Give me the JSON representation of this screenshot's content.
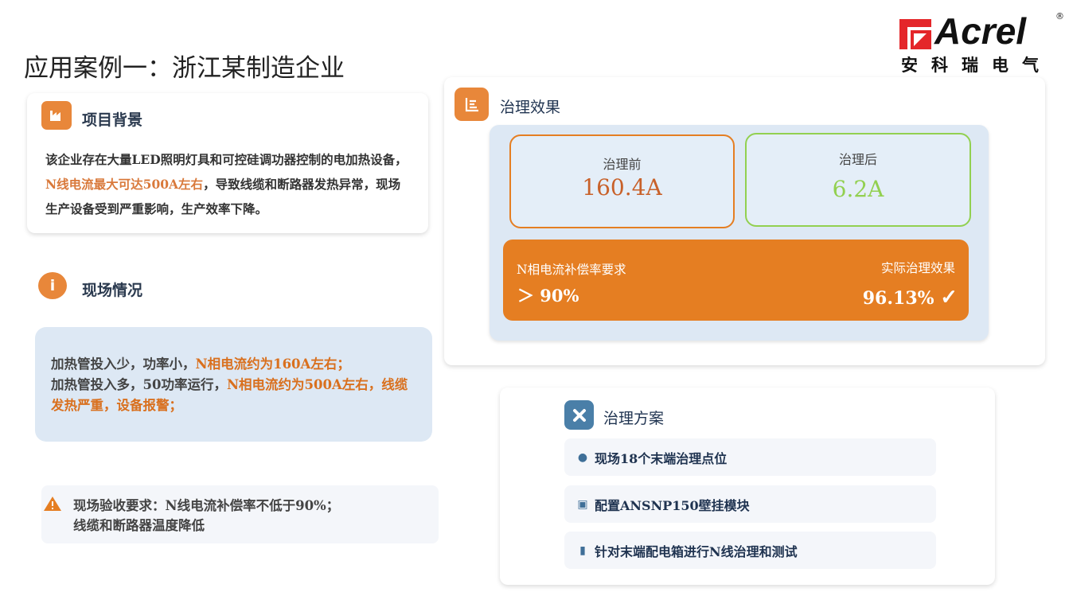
{
  "page": {
    "title": "应用案例一：浙江某制造企业"
  },
  "logo": {
    "brand": "Acrel",
    "cn": "安科瑞电气",
    "reg": "®"
  },
  "background": {
    "heading": "项目背景",
    "text_a": "该企业存在大量LED照明灯具和可控硅调功器控制的电加热设备，",
    "highlight": "N线电流最大可达500A左右",
    "text_b": "，导致线缆和断路器发热异常，现场生产设备受到严重影响，生产效率下降。"
  },
  "situation": {
    "heading": "现场情况",
    "l1a": "加热管投入少，功率小，",
    "l1b": "N相电流约为160A左右；",
    "l2a": "加热管投入多，50功率运行，",
    "l2b": "N相电流约为500A左右，线缆发热严重，设备报警；"
  },
  "acceptance": {
    "line1": "现场验收要求：N线电流补偿率不低于90%；",
    "line2": "线缆和断路器温度降低"
  },
  "effect": {
    "heading": "治理效果",
    "before_label": "治理前",
    "before_value": "160.4A",
    "after_label": "治理后",
    "after_value": "6.2A",
    "req_label": "N相电流补偿率要求",
    "req_value": "＞ 90%",
    "actual_label": "实际治理效果",
    "actual_value": "96.13%",
    "check": "✓"
  },
  "plan": {
    "heading": "治理方案",
    "items": [
      {
        "text": "现场18个末端治理点位"
      },
      {
        "text": "配置ANSNP150壁挂模块"
      },
      {
        "text": "针对末端配电箱进行N线治理和测试"
      }
    ]
  },
  "colors": {
    "orange": "#e57e22",
    "green": "#92d050",
    "blue_bg": "#dde8f4",
    "plan_icon": "#4a7fa8"
  }
}
